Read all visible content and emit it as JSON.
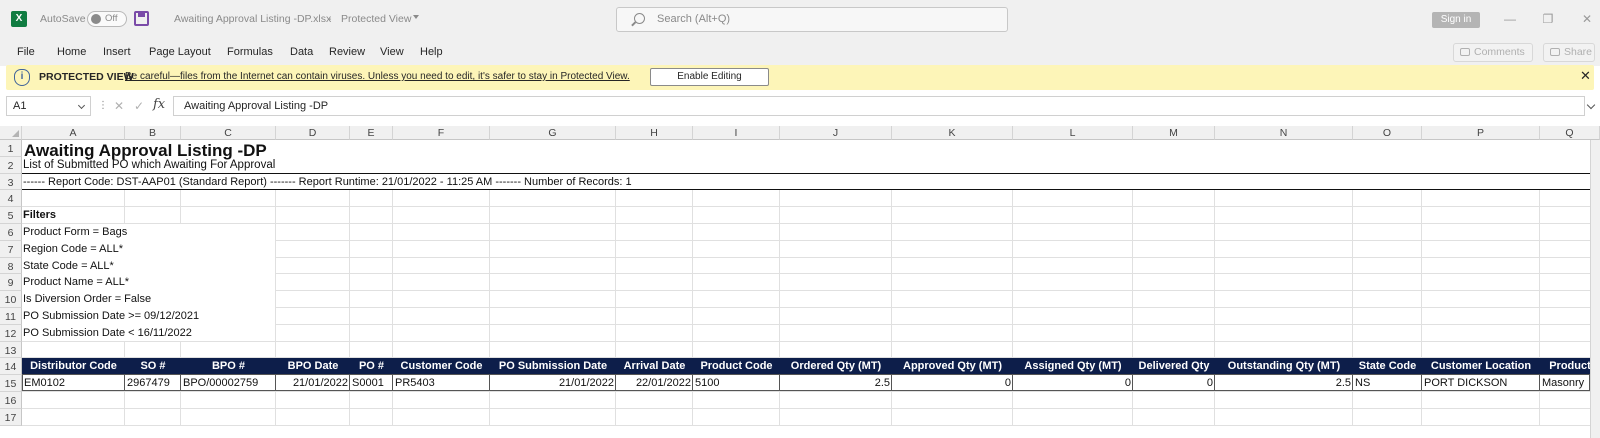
{
  "titlebar": {
    "app_icon": "excel-icon",
    "autosave_label": "AutoSave",
    "autosave_state": "Off",
    "file_name": "Awaiting Approval Listing -DP.xlsx",
    "separator": "-",
    "view_mode": "Protected View",
    "search_placeholder": "Search (Alt+Q)",
    "sign_in": "Sign in",
    "minimize": "—",
    "restore": "❐",
    "close": "✕"
  },
  "menu": {
    "items": [
      "File",
      "Home",
      "Insert",
      "Page Layout",
      "Formulas",
      "Data",
      "Review",
      "View",
      "Help"
    ],
    "comments": "Comments",
    "share": "Share"
  },
  "protected_view": {
    "title": "PROTECTED VIEW",
    "message": "Be careful—files from the Internet can contain viruses. Unless you need to edit, it's safer to stay in Protected View.",
    "button": "Enable Editing",
    "close": "✕"
  },
  "formula_bar": {
    "name_box": "A1",
    "cancel": "✕",
    "enter": "✓",
    "fx": "fx",
    "content": "Awaiting Approval Listing -DP"
  },
  "grid": {
    "columns": [
      "A",
      "B",
      "C",
      "D",
      "E",
      "F",
      "G",
      "H",
      "I",
      "J",
      "K",
      "L",
      "M",
      "N",
      "O",
      "P",
      "Q"
    ],
    "rows": [
      "1",
      "2",
      "3",
      "4",
      "5",
      "6",
      "7",
      "8",
      "9",
      "10",
      "11",
      "12",
      "13",
      "14",
      "15",
      "16",
      "17"
    ],
    "title": "Awaiting Approval Listing -DP",
    "subtitle": "List of Submitted PO which Awaiting For Approval",
    "report_line": "------ Report Code: DST-AAP01 (Standard Report) ------- Report Runtime: 21/01/2022 - 11:25 AM ------- Number of Records: 1",
    "filters_heading": "Filters",
    "filters": [
      "Product Form = Bags",
      "Region Code = ALL*",
      "State Code = ALL*",
      "Product Name = ALL*",
      "Is Diversion Order = False",
      "PO Submission Date >= 09/12/2021",
      "PO Submission Date < 16/11/2022"
    ],
    "table_headers": [
      "Distributor Code",
      "SO #",
      "BPO #",
      "BPO Date",
      "PO #",
      "Customer Code",
      "PO Submission Date",
      "Arrival Date",
      "Product Code",
      "Ordered Qty (MT)",
      "Approved Qty (MT)",
      "Assigned Qty (MT)",
      "Delivered Qty",
      "Outstanding Qty (MT)",
      "State Code",
      "Customer Location",
      "Product"
    ],
    "table_row": [
      "EM0102",
      "2967479",
      "BPO/00002759",
      "21/01/2022",
      "S0001",
      "PR5403",
      "21/01/2022",
      "22/01/2022",
      "5100",
      "2.5",
      "0",
      "0",
      "0",
      "2.5",
      "NS",
      "PORT DICKSON",
      "Masonry"
    ]
  }
}
